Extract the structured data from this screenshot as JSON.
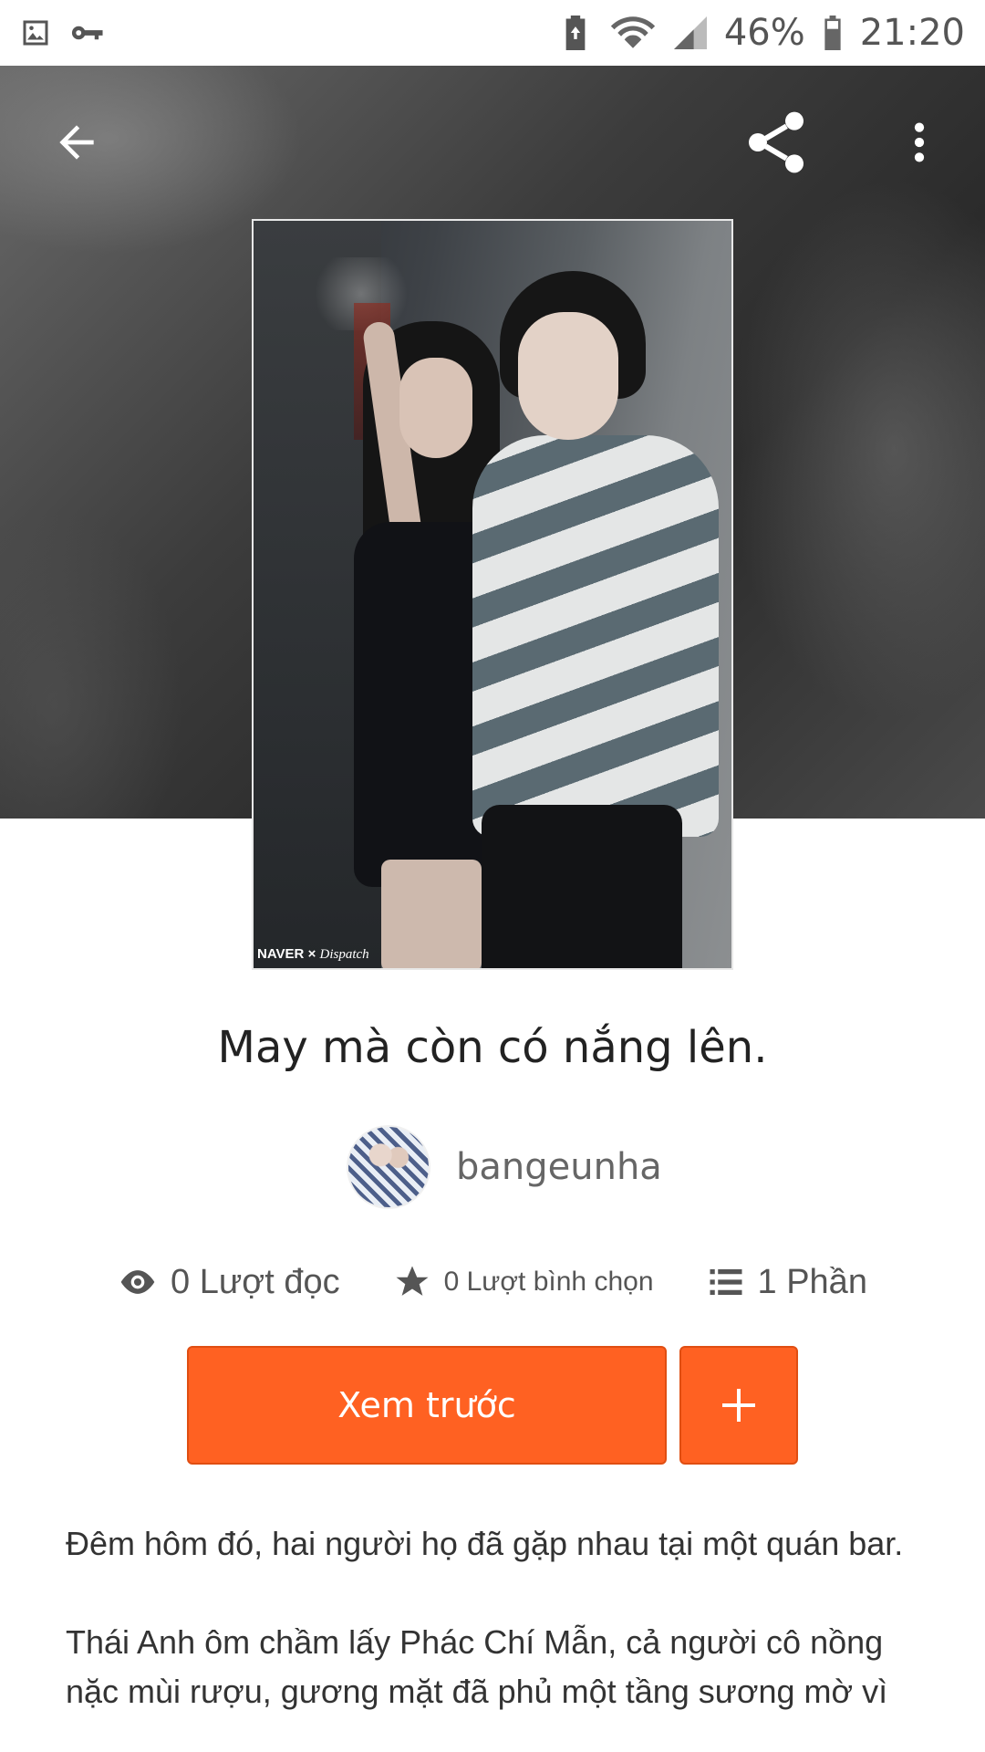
{
  "status_bar": {
    "left_icons": [
      "image-icon",
      "key-icon"
    ],
    "right_icons": [
      "battery-saver-icon",
      "wifi-icon",
      "signal-icon",
      "battery-icon"
    ],
    "battery": "46%",
    "time": "21:20"
  },
  "toolbar": {
    "back_icon": "arrow-left-icon",
    "share_icon": "share-icon",
    "more_icon": "more-vertical-icon"
  },
  "cover": {
    "watermark_brand": "NAVER",
    "watermark_text": "Dispatch"
  },
  "story": {
    "title": "May mà còn có nắng lên.",
    "author": "bangeunha"
  },
  "stats": {
    "reads": "0 Lượt đọc",
    "votes": "0 Lượt bình chọn",
    "parts": "1 Phần"
  },
  "actions": {
    "preview_label": "Xem trước",
    "add_label": "+"
  },
  "description": {
    "paragraph1": "Đêm hôm đó, hai người họ đã gặp nhau tại một quán bar.",
    "paragraph2": "Thái Anh ôm chầm lấy Phác Chí Mẫn, cả người cô nồng nặc mùi rượu, gương mặt đã phủ một tầng sương mờ vì"
  },
  "colors": {
    "accent": "#ff6122",
    "hero_dark": "#3c3c3c"
  }
}
